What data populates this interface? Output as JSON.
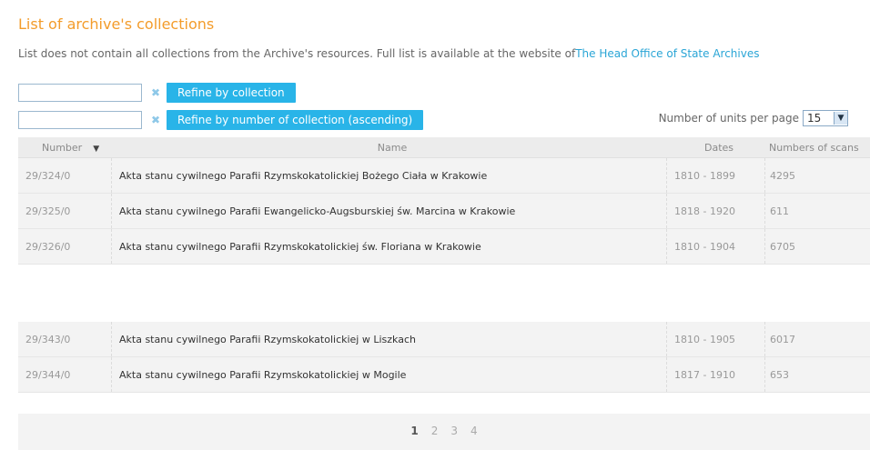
{
  "header": {
    "title": "List of archive's collections",
    "intro_text": "List does not contain all collections from the Archive's resources. Full list is available at the website of",
    "intro_link": "The Head Office of State Archives"
  },
  "filters": {
    "collection_value": "",
    "collection_button": "Refine by collection",
    "number_value": "",
    "number_button": "Refine by number of collection (ascending)",
    "clear_glyph": "✖"
  },
  "per_page": {
    "label": "Number of units per page",
    "value": "15"
  },
  "table": {
    "headers": {
      "number": "Number",
      "name": "Name",
      "dates": "Dates",
      "scans": "Numbers of scans"
    },
    "rows_top": [
      {
        "number": "29/324/0",
        "name": "Akta stanu cywilnego Parafii Rzymskokatolickiej Bożego Ciała w Krakowie",
        "dates": "1810 - 1899",
        "scans": "4295"
      },
      {
        "number": "29/325/0",
        "name": "Akta stanu cywilnego Parafii Ewangelicko-Augsburskiej św. Marcina w Krakowie",
        "dates": "1818 - 1920",
        "scans": "611"
      },
      {
        "number": "29/326/0",
        "name": "Akta stanu cywilnego Parafii Rzymskokatolickiej św. Floriana w Krakowie",
        "dates": "1810 - 1904",
        "scans": "6705"
      }
    ],
    "rows_bottom": [
      {
        "number": "29/343/0",
        "name": "Akta stanu cywilnego Parafii Rzymskokatolickiej w Liszkach",
        "dates": "1810 - 1905",
        "scans": "6017"
      },
      {
        "number": "29/344/0",
        "name": "Akta stanu cywilnego Parafii Rzymskokatolickiej w Mogile",
        "dates": "1817 - 1910",
        "scans": "653"
      }
    ]
  },
  "pagination": {
    "pages": [
      "1",
      "2",
      "3",
      "4"
    ],
    "current": "1"
  },
  "colors": {
    "title": "#f39c2b",
    "link": "#2aa5d6",
    "button": "#29b4e8"
  }
}
